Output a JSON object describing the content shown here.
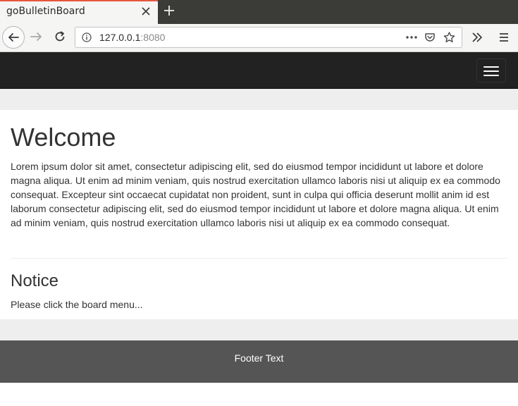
{
  "browser": {
    "tab": {
      "title": "goBulletinBoard",
      "accent_color": "#e6583e"
    },
    "address_bar": {
      "host": "127.0.0.1",
      "port": ":8080"
    },
    "icons": [
      "back-arrow-icon",
      "forward-arrow-icon",
      "reload-icon",
      "info-icon",
      "more-dots-icon",
      "pocket-icon",
      "bookmark-star-icon",
      "overflow-chevrons-icon",
      "hamburger-menu-icon"
    ]
  },
  "page": {
    "header": {
      "background": "#222222",
      "toggle_icon": "hamburger-icon"
    },
    "welcome": {
      "title": "Welcome",
      "body": "Lorem ipsum dolor sit amet, consectetur adipiscing elit, sed do eiusmod tempor incididunt ut labore et dolore magna aliqua. Ut enim ad minim veniam, quis nostrud exercitation ullamco laboris nisi ut aliquip ex ea commodo consequat. Excepteur sint occaecat cupidatat non proident, sunt in culpa qui officia deserunt mollit anim id est laborum consectetur adipiscing elit, sed do eiusmod tempor incididunt ut labore et dolore magna aliqua. Ut enim ad minim veniam, quis nostrud exercitation ullamco laboris nisi ut aliquip ex ea commodo consequat."
    },
    "notice": {
      "title": "Notice",
      "body": "Please click the board menu..."
    },
    "footer": {
      "text": "Footer Text",
      "background": "#555555"
    }
  }
}
